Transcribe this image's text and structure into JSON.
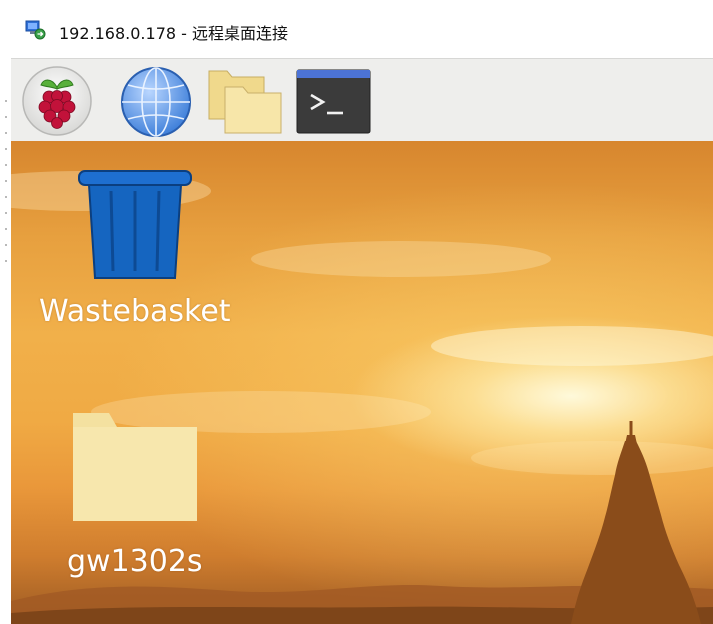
{
  "window": {
    "title": "192.168.0.178 - 远程桌面连接",
    "title_icon": "remote-desktop-icon"
  },
  "taskbar": {
    "items": [
      {
        "name": "raspberry-pi-menu",
        "icon": "raspberry-icon"
      },
      {
        "name": "web-browser",
        "icon": "globe-icon"
      },
      {
        "name": "file-manager",
        "icon": "folder-icon"
      },
      {
        "name": "terminal",
        "icon": "terminal-icon",
        "glyph": ">_"
      }
    ]
  },
  "desktop": {
    "icons": [
      {
        "label": "Wastebasket",
        "icon": "trash-icon"
      },
      {
        "label": "gw1302s",
        "icon": "folder-icon"
      }
    ]
  },
  "colors": {
    "taskbar_bg": "#eeeeec",
    "trash_blue": "#1565c0",
    "folder_yellow": "#f4e3a6",
    "terminal_dark": "#3e3e3e",
    "terminal_bar": "#4a6dd0"
  }
}
